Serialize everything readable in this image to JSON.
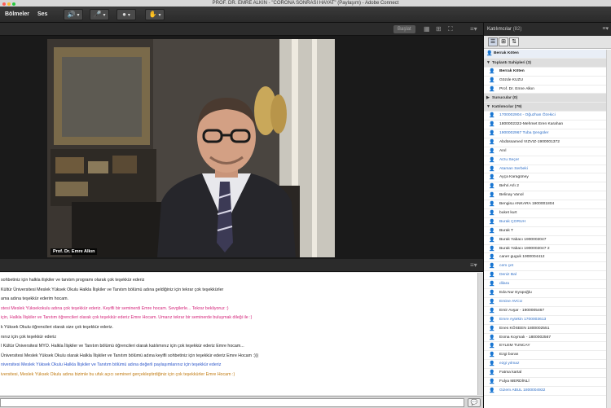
{
  "window": {
    "title": "PROF. DR. EMRE ALKIN - \"CORONA SONRASI HAYAT\" (Paylaşım) - Adobe Connect"
  },
  "menubar": {
    "items": [
      "Bölmeler",
      "Ses"
    ]
  },
  "video_pod": {
    "share_label": "Başlat",
    "presenter_label": "Prof. Dr. Emre Alkın"
  },
  "chat": {
    "messages": [
      {
        "text": "sohbetiniz için halkla ilişkiler ve tanıtım programı olarak çok teşekkür ederiz",
        "color": "#222222"
      },
      {
        "text": "Kültür Üniversitesi Meslek Yüksek Okulu Halkla İlişkiler ve Tanıtım bölümü adına geldiğiniz için tekrar çok teşekkürler",
        "color": "#222222"
      },
      {
        "text": "ama adına teşekkür ederim hocam.",
        "color": "#222222"
      },
      {
        "text": "stesi Meslek Yüksekokulu adına çok teşekkür ederiz. Keyifli bir seminerdi Emre hocam. Sevgilerle... Tekrar bekliyoruz :)",
        "color": "#d4247a"
      },
      {
        "text": "için, Halkla İlişkiler ve Tanıtım öğrencileri olarak çok teşekkür ederiz Emre Hocam. Umarız tekrar bir seminerde buluşmak dileği ile :)",
        "color": "#d4247a"
      },
      {
        "text": "k Yüksek Okulu öğrencileri olarak size çok teşekkür ederiz.",
        "color": "#222222"
      },
      {
        "text": "nınız için çok teşekkür ederiz",
        "color": "#222222"
      },
      {
        "text": "l Kültür Üniversitesi MYO. Halkla İlişkiler ve Tanıtım bölümü öğrencileri olarak katılımınız için çok teşekkür ederiz Emre hocam...",
        "color": "#222222"
      },
      {
        "text": "Üniversitesi Meslek Yüksek Okulu olarak Halkla İlişkiler ve Tanıtım bölümü adına keyifli sohbetiniz için teşekkür ederiz Emre Hocam :)))",
        "color": "#222222"
      },
      {
        "text": "niversitesi Meslek Yüksek Okulu Halkla İlişkiler ve Tanıtım bölümü adına değerli paylaşımlarınız için teşekkür ederiz",
        "color": "#2b55c9"
      },
      {
        "text": "iversitesi, Meslek Yüksek Okulu adına bizimle bu ufuk açıcı semineri gerçekleştirdiğiniz için çok teşekkürler Emre Hocam :)",
        "color": "#c07a10"
      }
    ]
  },
  "attendees": {
    "header": "Katılımcılar",
    "count": "(82)",
    "current_user": "Berrak Köten",
    "groups": [
      {
        "label": "Toplantı Sahipleri (3)",
        "members": [
          {
            "name": "Berrak Köten",
            "style": "bold"
          },
          {
            "name": "Gözde KUZU",
            "style": "normal"
          },
          {
            "name": "Prof. Dr. Emre Alkın",
            "style": "normal"
          }
        ]
      },
      {
        "label": "Sunucular (0)",
        "members": []
      },
      {
        "label": "Katılımcılar (79)",
        "members": [
          {
            "name": "1700002904 - Oğuzhan Özekici",
            "style": "blue"
          },
          {
            "name": "1800002322-Mehmet Eren Karahan",
            "style": "normal"
          },
          {
            "name": "1900002967 Tuba Şengüler",
            "style": "blue"
          },
          {
            "name": "Abdüssamed VIZVIZ-1900001372",
            "style": "normal"
          },
          {
            "name": "Anıl",
            "style": "normal"
          },
          {
            "name": "Arzu Seçer",
            "style": "blue"
          },
          {
            "name": "Ataman Serbeki",
            "style": "blue"
          },
          {
            "name": "Ayça Karagüney",
            "style": "normal"
          },
          {
            "name": "Behri Arlı 2",
            "style": "normal"
          },
          {
            "name": "Belinay Vanol",
            "style": "normal"
          },
          {
            "name": "Bengisu ANKARA 1900001804",
            "style": "normal"
          },
          {
            "name": "buket kurt",
            "style": "normal"
          },
          {
            "name": "Burak ÇORUH",
            "style": "blue"
          },
          {
            "name": "Burak T",
            "style": "normal"
          },
          {
            "name": "Burak Yabacı 1900002047",
            "style": "normal"
          },
          {
            "name": "Burak Yabacı 1900002047 2",
            "style": "normal"
          },
          {
            "name": "caner guguk 1900004412",
            "style": "normal"
          },
          {
            "name": "cem çet",
            "style": "blue"
          },
          {
            "name": "Deniz Bal",
            "style": "blue"
          },
          {
            "name": "dilara",
            "style": "blue"
          },
          {
            "name": "Eda Nur Eyüpoğlu",
            "style": "normal"
          },
          {
            "name": "Emine AVCU",
            "style": "blue"
          },
          {
            "name": "Emir Avşar - 1900005467",
            "style": "normal"
          },
          {
            "name": "Emre Aytekin 1700003613",
            "style": "blue"
          },
          {
            "name": "Enes KÖSEEN 1800002551",
            "style": "normal"
          },
          {
            "name": "Esma Koymalı - 1800002567",
            "style": "normal"
          },
          {
            "name": "EYLEM TUNCAY",
            "style": "normal"
          },
          {
            "name": "Ezgi boran",
            "style": "normal"
          },
          {
            "name": "ezgi yılmaz",
            "style": "blue"
          },
          {
            "name": "Fatma kartal",
            "style": "normal"
          },
          {
            "name": "Fulya MERDİNLİ",
            "style": "normal"
          },
          {
            "name": "Gizem ABUL 1800004932",
            "style": "blue"
          }
        ]
      }
    ]
  },
  "colors": {
    "chrome_dark": "#2b2b2b",
    "accent_blue": "#2f6fc7",
    "chat_pink": "#d4247a",
    "chat_blue": "#2b55c9",
    "chat_orange": "#c07a10"
  }
}
